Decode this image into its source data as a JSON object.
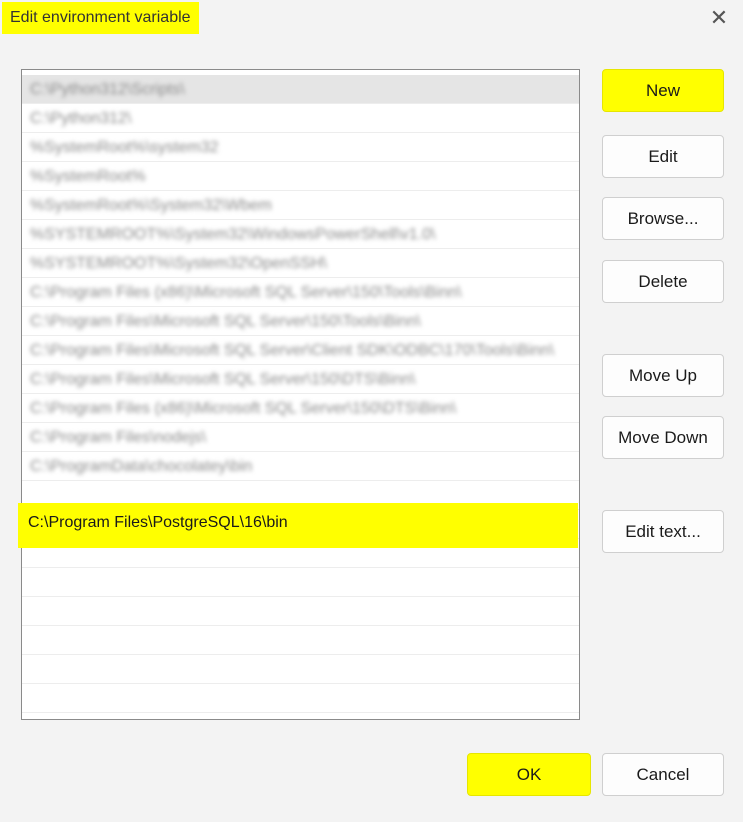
{
  "window": {
    "title": "Edit environment variable",
    "close_glyph": "✕"
  },
  "list": {
    "items": [
      "C:\\Python312\\Scripts\\",
      "C:\\Python312\\",
      "%SystemRoot%\\system32",
      "%SystemRoot%",
      "%SystemRoot%\\System32\\Wbem",
      "%SYSTEMROOT%\\System32\\WindowsPowerShell\\v1.0\\",
      "%SYSTEMROOT%\\System32\\OpenSSH\\",
      "C:\\Program Files (x86)\\Microsoft SQL Server\\150\\Tools\\Binn\\",
      "C:\\Program Files\\Microsoft SQL Server\\150\\Tools\\Binn\\",
      "C:\\Program Files\\Microsoft SQL Server\\Client SDK\\ODBC\\170\\Tools\\Binn\\",
      "C:\\Program Files\\Microsoft SQL Server\\150\\DTS\\Binn\\",
      "C:\\Program Files (x86)\\Microsoft SQL Server\\150\\DTS\\Binn\\",
      "C:\\Program Files\\nodejs\\",
      "C:\\ProgramData\\chocolatey\\bin",
      "C:\\Program Files\\PostgreSQL\\16\\bin"
    ],
    "new_item": "C:\\Program Files\\PostgreSQL\\16\\bin"
  },
  "buttons": {
    "new": "New",
    "edit": "Edit",
    "browse": "Browse...",
    "delete": "Delete",
    "move_up": "Move Up",
    "move_down": "Move Down",
    "edit_text": "Edit text...",
    "ok": "OK",
    "cancel": "Cancel"
  },
  "colors": {
    "highlight": "#ffff00",
    "background": "#f3f3f3",
    "list_bg": "#ffffff"
  }
}
